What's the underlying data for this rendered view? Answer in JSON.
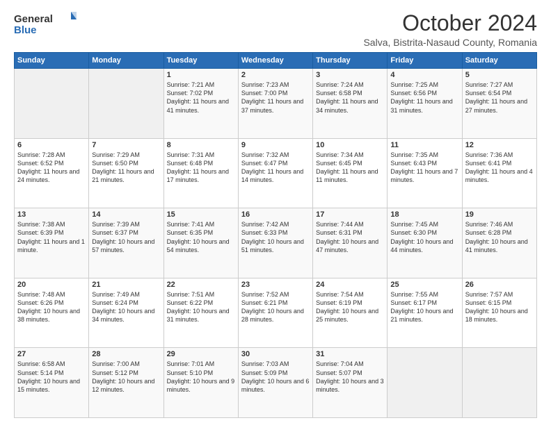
{
  "header": {
    "logo_general": "General",
    "logo_blue": "Blue",
    "month_title": "October 2024",
    "location": "Salva, Bistrita-Nasaud County, Romania"
  },
  "weekdays": [
    "Sunday",
    "Monday",
    "Tuesday",
    "Wednesday",
    "Thursday",
    "Friday",
    "Saturday"
  ],
  "weeks": [
    [
      {
        "day": "",
        "sunrise": "",
        "sunset": "",
        "daylight": ""
      },
      {
        "day": "",
        "sunrise": "",
        "sunset": "",
        "daylight": ""
      },
      {
        "day": "1",
        "sunrise": "Sunrise: 7:21 AM",
        "sunset": "Sunset: 7:02 PM",
        "daylight": "Daylight: 11 hours and 41 minutes."
      },
      {
        "day": "2",
        "sunrise": "Sunrise: 7:23 AM",
        "sunset": "Sunset: 7:00 PM",
        "daylight": "Daylight: 11 hours and 37 minutes."
      },
      {
        "day": "3",
        "sunrise": "Sunrise: 7:24 AM",
        "sunset": "Sunset: 6:58 PM",
        "daylight": "Daylight: 11 hours and 34 minutes."
      },
      {
        "day": "4",
        "sunrise": "Sunrise: 7:25 AM",
        "sunset": "Sunset: 6:56 PM",
        "daylight": "Daylight: 11 hours and 31 minutes."
      },
      {
        "day": "5",
        "sunrise": "Sunrise: 7:27 AM",
        "sunset": "Sunset: 6:54 PM",
        "daylight": "Daylight: 11 hours and 27 minutes."
      }
    ],
    [
      {
        "day": "6",
        "sunrise": "Sunrise: 7:28 AM",
        "sunset": "Sunset: 6:52 PM",
        "daylight": "Daylight: 11 hours and 24 minutes."
      },
      {
        "day": "7",
        "sunrise": "Sunrise: 7:29 AM",
        "sunset": "Sunset: 6:50 PM",
        "daylight": "Daylight: 11 hours and 21 minutes."
      },
      {
        "day": "8",
        "sunrise": "Sunrise: 7:31 AM",
        "sunset": "Sunset: 6:48 PM",
        "daylight": "Daylight: 11 hours and 17 minutes."
      },
      {
        "day": "9",
        "sunrise": "Sunrise: 7:32 AM",
        "sunset": "Sunset: 6:47 PM",
        "daylight": "Daylight: 11 hours and 14 minutes."
      },
      {
        "day": "10",
        "sunrise": "Sunrise: 7:34 AM",
        "sunset": "Sunset: 6:45 PM",
        "daylight": "Daylight: 11 hours and 11 minutes."
      },
      {
        "day": "11",
        "sunrise": "Sunrise: 7:35 AM",
        "sunset": "Sunset: 6:43 PM",
        "daylight": "Daylight: 11 hours and 7 minutes."
      },
      {
        "day": "12",
        "sunrise": "Sunrise: 7:36 AM",
        "sunset": "Sunset: 6:41 PM",
        "daylight": "Daylight: 11 hours and 4 minutes."
      }
    ],
    [
      {
        "day": "13",
        "sunrise": "Sunrise: 7:38 AM",
        "sunset": "Sunset: 6:39 PM",
        "daylight": "Daylight: 11 hours and 1 minute."
      },
      {
        "day": "14",
        "sunrise": "Sunrise: 7:39 AM",
        "sunset": "Sunset: 6:37 PM",
        "daylight": "Daylight: 10 hours and 57 minutes."
      },
      {
        "day": "15",
        "sunrise": "Sunrise: 7:41 AM",
        "sunset": "Sunset: 6:35 PM",
        "daylight": "Daylight: 10 hours and 54 minutes."
      },
      {
        "day": "16",
        "sunrise": "Sunrise: 7:42 AM",
        "sunset": "Sunset: 6:33 PM",
        "daylight": "Daylight: 10 hours and 51 minutes."
      },
      {
        "day": "17",
        "sunrise": "Sunrise: 7:44 AM",
        "sunset": "Sunset: 6:31 PM",
        "daylight": "Daylight: 10 hours and 47 minutes."
      },
      {
        "day": "18",
        "sunrise": "Sunrise: 7:45 AM",
        "sunset": "Sunset: 6:30 PM",
        "daylight": "Daylight: 10 hours and 44 minutes."
      },
      {
        "day": "19",
        "sunrise": "Sunrise: 7:46 AM",
        "sunset": "Sunset: 6:28 PM",
        "daylight": "Daylight: 10 hours and 41 minutes."
      }
    ],
    [
      {
        "day": "20",
        "sunrise": "Sunrise: 7:48 AM",
        "sunset": "Sunset: 6:26 PM",
        "daylight": "Daylight: 10 hours and 38 minutes."
      },
      {
        "day": "21",
        "sunrise": "Sunrise: 7:49 AM",
        "sunset": "Sunset: 6:24 PM",
        "daylight": "Daylight: 10 hours and 34 minutes."
      },
      {
        "day": "22",
        "sunrise": "Sunrise: 7:51 AM",
        "sunset": "Sunset: 6:22 PM",
        "daylight": "Daylight: 10 hours and 31 minutes."
      },
      {
        "day": "23",
        "sunrise": "Sunrise: 7:52 AM",
        "sunset": "Sunset: 6:21 PM",
        "daylight": "Daylight: 10 hours and 28 minutes."
      },
      {
        "day": "24",
        "sunrise": "Sunrise: 7:54 AM",
        "sunset": "Sunset: 6:19 PM",
        "daylight": "Daylight: 10 hours and 25 minutes."
      },
      {
        "day": "25",
        "sunrise": "Sunrise: 7:55 AM",
        "sunset": "Sunset: 6:17 PM",
        "daylight": "Daylight: 10 hours and 21 minutes."
      },
      {
        "day": "26",
        "sunrise": "Sunrise: 7:57 AM",
        "sunset": "Sunset: 6:15 PM",
        "daylight": "Daylight: 10 hours and 18 minutes."
      }
    ],
    [
      {
        "day": "27",
        "sunrise": "Sunrise: 6:58 AM",
        "sunset": "Sunset: 5:14 PM",
        "daylight": "Daylight: 10 hours and 15 minutes."
      },
      {
        "day": "28",
        "sunrise": "Sunrise: 7:00 AM",
        "sunset": "Sunset: 5:12 PM",
        "daylight": "Daylight: 10 hours and 12 minutes."
      },
      {
        "day": "29",
        "sunrise": "Sunrise: 7:01 AM",
        "sunset": "Sunset: 5:10 PM",
        "daylight": "Daylight: 10 hours and 9 minutes."
      },
      {
        "day": "30",
        "sunrise": "Sunrise: 7:03 AM",
        "sunset": "Sunset: 5:09 PM",
        "daylight": "Daylight: 10 hours and 6 minutes."
      },
      {
        "day": "31",
        "sunrise": "Sunrise: 7:04 AM",
        "sunset": "Sunset: 5:07 PM",
        "daylight": "Daylight: 10 hours and 3 minutes."
      },
      {
        "day": "",
        "sunrise": "",
        "sunset": "",
        "daylight": ""
      },
      {
        "day": "",
        "sunrise": "",
        "sunset": "",
        "daylight": ""
      }
    ]
  ]
}
